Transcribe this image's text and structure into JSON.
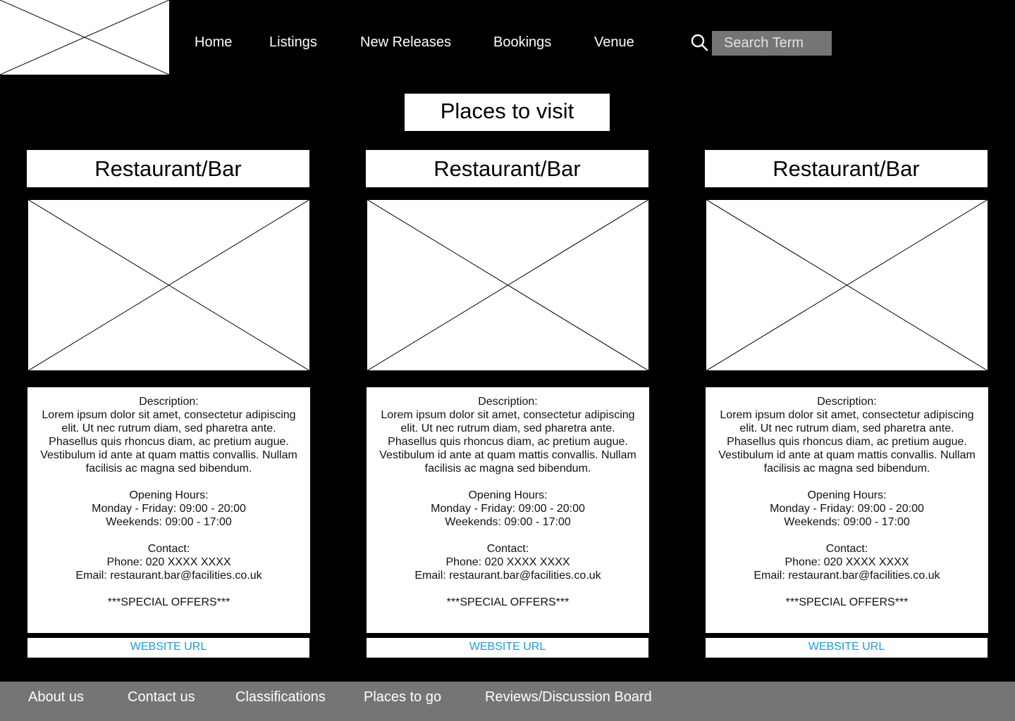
{
  "nav": {
    "home": "Home",
    "listings": "Listings",
    "new_releases": "New Releases",
    "bookings": "Bookings",
    "venue": "Venue"
  },
  "search": {
    "placeholder": "Search Term",
    "icon": "search-icon"
  },
  "page_title": "Places to visit",
  "cards": [
    {
      "title": "Restaurant/Bar",
      "description_label": "Description:",
      "description": "Lorem ipsum dolor sit amet, consectetur adipiscing elit. Ut nec rutrum diam, sed pharetra ante. Phasellus quis rhoncus diam, ac pretium augue. Vestibulum id ante at quam mattis convallis. Nullam facilisis ac magna sed bibendum.",
      "hours_label": "Opening Hours:",
      "hours_weekday": "Monday - Friday: 09:00 - 20:00",
      "hours_weekend": "Weekends: 09:00 - 17:00",
      "contact_label": "Contact:",
      "phone": "Phone: 020 XXXX XXXX",
      "email": "Email: restaurant.bar@facilities.co.uk",
      "offers": "***SPECIAL OFFERS***",
      "url": "WEBSITE URL"
    },
    {
      "title": "Restaurant/Bar",
      "description_label": "Description:",
      "description": "Lorem ipsum dolor sit amet, consectetur adipiscing elit. Ut nec rutrum diam, sed pharetra ante. Phasellus quis rhoncus diam, ac pretium augue. Vestibulum id ante at quam mattis convallis. Nullam facilisis ac magna sed bibendum.",
      "hours_label": "Opening Hours:",
      "hours_weekday": "Monday - Friday: 09:00 - 20:00",
      "hours_weekend": "Weekends: 09:00 - 17:00",
      "contact_label": "Contact:",
      "phone": "Phone: 020 XXXX XXXX",
      "email": "Email: restaurant.bar@facilities.co.uk",
      "offers": "***SPECIAL OFFERS***",
      "url": "WEBSITE URL"
    },
    {
      "title": "Restaurant/Bar",
      "description_label": "Description:",
      "description": "Lorem ipsum dolor sit amet, consectetur adipiscing elit. Ut nec rutrum diam, sed pharetra ante. Phasellus quis rhoncus diam, ac pretium augue. Vestibulum id ante at quam mattis convallis. Nullam facilisis ac magna sed bibendum.",
      "hours_label": "Opening Hours:",
      "hours_weekday": "Monday - Friday: 09:00 - 20:00",
      "hours_weekend": "Weekends: 09:00 - 17:00",
      "contact_label": "Contact:",
      "phone": "Phone: 020 XXXX XXXX",
      "email": "Email: restaurant.bar@facilities.co.uk",
      "offers": "***SPECIAL OFFERS***",
      "url": "WEBSITE URL"
    }
  ],
  "footer": {
    "about": "About us",
    "contact": "Contact us",
    "classifications": "Classifications",
    "places": "Places to go",
    "reviews": "Reviews/Discussion Board"
  },
  "colors": {
    "background": "#000000",
    "panel": "#ffffff",
    "footer": "#757575",
    "search_field": "#757575",
    "link": "#1d9be0"
  }
}
